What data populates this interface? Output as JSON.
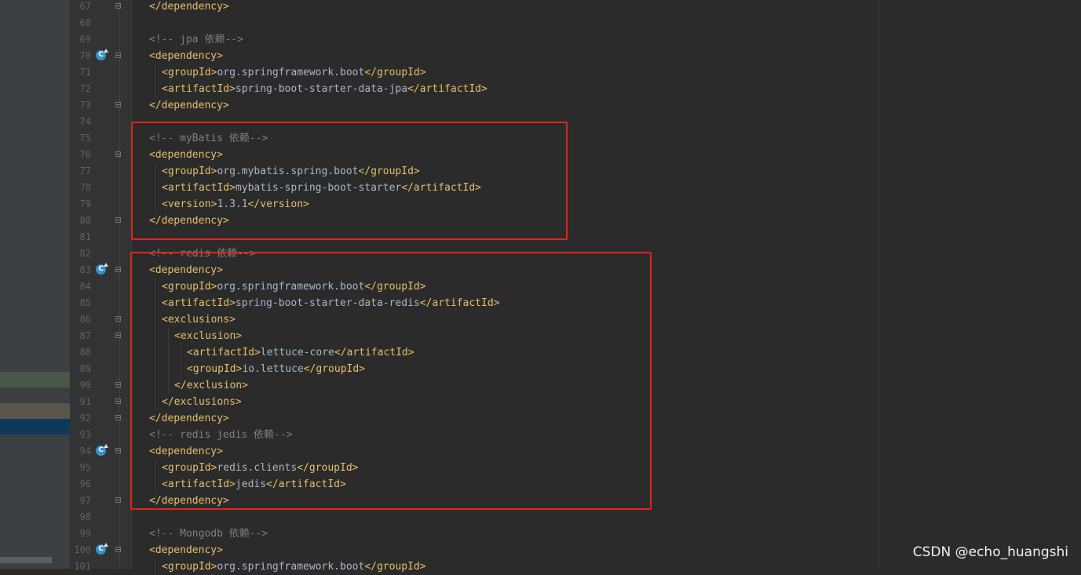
{
  "editor": {
    "lines": [
      {
        "num": "67",
        "indent": 0,
        "fold": true,
        "parts": [
          {
            "t": "tag",
            "v": "</dependency>"
          }
        ]
      },
      {
        "num": "68",
        "indent": 0,
        "parts": []
      },
      {
        "num": "69",
        "indent": 0,
        "parts": [
          {
            "t": "cmt",
            "v": "<!-- jpa 依赖-->"
          }
        ]
      },
      {
        "num": "70",
        "indent": 0,
        "badge": true,
        "fold": true,
        "parts": [
          {
            "t": "tag",
            "v": "<dependency>"
          }
        ]
      },
      {
        "num": "71",
        "indent": 1,
        "parts": [
          {
            "t": "tag",
            "v": "<groupId>"
          },
          {
            "t": "txt",
            "v": "org.springframework.boot"
          },
          {
            "t": "tag",
            "v": "</groupId>"
          }
        ]
      },
      {
        "num": "72",
        "indent": 1,
        "parts": [
          {
            "t": "tag",
            "v": "<artifactId>"
          },
          {
            "t": "txt",
            "v": "spring-boot-starter-data-jpa"
          },
          {
            "t": "tag",
            "v": "</artifactId>"
          }
        ]
      },
      {
        "num": "73",
        "indent": 0,
        "fold": true,
        "parts": [
          {
            "t": "tag",
            "v": "</dependency>"
          }
        ]
      },
      {
        "num": "74",
        "indent": 0,
        "parts": []
      },
      {
        "num": "75",
        "indent": 0,
        "parts": [
          {
            "t": "cmt",
            "v": "<!-- myBatis 依赖-->"
          }
        ]
      },
      {
        "num": "76",
        "indent": 0,
        "fold": true,
        "parts": [
          {
            "t": "tag",
            "v": "<dependency>"
          }
        ]
      },
      {
        "num": "77",
        "indent": 1,
        "parts": [
          {
            "t": "tag",
            "v": "<groupId>"
          },
          {
            "t": "txt",
            "v": "org.mybatis.spring.boot"
          },
          {
            "t": "tag",
            "v": "</groupId>"
          }
        ]
      },
      {
        "num": "78",
        "indent": 1,
        "parts": [
          {
            "t": "tag",
            "v": "<artifactId>"
          },
          {
            "t": "txt",
            "v": "mybatis-spring-boot-starter"
          },
          {
            "t": "tag",
            "v": "</artifactId>"
          }
        ]
      },
      {
        "num": "79",
        "indent": 1,
        "parts": [
          {
            "t": "tag",
            "v": "<version>"
          },
          {
            "t": "txt",
            "v": "1.3.1"
          },
          {
            "t": "tag",
            "v": "</version>"
          }
        ]
      },
      {
        "num": "80",
        "indent": 0,
        "fold": true,
        "parts": [
          {
            "t": "tag",
            "v": "</dependency>"
          }
        ]
      },
      {
        "num": "81",
        "indent": 0,
        "parts": []
      },
      {
        "num": "82",
        "indent": 0,
        "parts": [
          {
            "t": "cmt",
            "v": "<!-- redis 依赖-->"
          }
        ]
      },
      {
        "num": "83",
        "indent": 0,
        "badge": true,
        "fold": true,
        "parts": [
          {
            "t": "tag",
            "v": "<dependency>"
          }
        ]
      },
      {
        "num": "84",
        "indent": 1,
        "parts": [
          {
            "t": "tag",
            "v": "<groupId>"
          },
          {
            "t": "txt",
            "v": "org.springframework.boot"
          },
          {
            "t": "tag",
            "v": "</groupId>"
          }
        ]
      },
      {
        "num": "85",
        "indent": 1,
        "parts": [
          {
            "t": "tag",
            "v": "<artifactId>"
          },
          {
            "t": "txt",
            "v": "spring-boot-starter-data-redis"
          },
          {
            "t": "tag",
            "v": "</artifactId>"
          }
        ]
      },
      {
        "num": "86",
        "indent": 1,
        "fold": true,
        "parts": [
          {
            "t": "tag",
            "v": "<exclusions>"
          }
        ]
      },
      {
        "num": "87",
        "indent": 2,
        "fold": true,
        "parts": [
          {
            "t": "tag",
            "v": "<exclusion>"
          }
        ]
      },
      {
        "num": "88",
        "indent": 3,
        "parts": [
          {
            "t": "tag",
            "v": "<artifactId>"
          },
          {
            "t": "txt",
            "v": "lettuce-core"
          },
          {
            "t": "tag",
            "v": "</artifactId>"
          }
        ]
      },
      {
        "num": "89",
        "indent": 3,
        "parts": [
          {
            "t": "tag",
            "v": "<groupId>"
          },
          {
            "t": "txt",
            "v": "io.lettuce"
          },
          {
            "t": "tag",
            "v": "</groupId>"
          }
        ]
      },
      {
        "num": "90",
        "indent": 2,
        "fold": true,
        "parts": [
          {
            "t": "tag",
            "v": "</exclusion>"
          }
        ]
      },
      {
        "num": "91",
        "indent": 1,
        "fold": true,
        "parts": [
          {
            "t": "tag",
            "v": "</exclusions>"
          }
        ]
      },
      {
        "num": "92",
        "indent": 0,
        "fold": true,
        "parts": [
          {
            "t": "tag",
            "v": "</dependency>"
          }
        ]
      },
      {
        "num": "93",
        "indent": 0,
        "parts": [
          {
            "t": "cmt",
            "v": "<!-- redis jedis 依赖-->"
          }
        ]
      },
      {
        "num": "94",
        "indent": 0,
        "badge": true,
        "fold": true,
        "parts": [
          {
            "t": "tag",
            "v": "<dependency>"
          }
        ]
      },
      {
        "num": "95",
        "indent": 1,
        "parts": [
          {
            "t": "tag",
            "v": "<groupId>"
          },
          {
            "t": "txt",
            "v": "redis.clients"
          },
          {
            "t": "tag",
            "v": "</groupId>"
          }
        ]
      },
      {
        "num": "96",
        "indent": 1,
        "parts": [
          {
            "t": "tag",
            "v": "<artifactId>"
          },
          {
            "t": "txt",
            "v": "jedis"
          },
          {
            "t": "tag",
            "v": "</artifactId>"
          }
        ]
      },
      {
        "num": "97",
        "indent": 0,
        "fold": true,
        "parts": [
          {
            "t": "tag",
            "v": "</dependency>"
          }
        ]
      },
      {
        "num": "98",
        "indent": 0,
        "parts": []
      },
      {
        "num": "99",
        "indent": 0,
        "parts": [
          {
            "t": "cmt",
            "v": "<!-- Mongodb 依赖-->"
          }
        ]
      },
      {
        "num": "100",
        "indent": 0,
        "badge": true,
        "fold": true,
        "parts": [
          {
            "t": "tag",
            "v": "<dependency>"
          }
        ]
      },
      {
        "num": "101",
        "indent": 1,
        "parts": [
          {
            "t": "tag",
            "v": "<groupId>"
          },
          {
            "t": "txt",
            "v": "org.springframework.boot"
          },
          {
            "t": "tag",
            "v": "</groupId>"
          }
        ]
      }
    ]
  },
  "badge_glyph": "C",
  "watermark": "CSDN @echo_huangshi",
  "colors": {
    "background": "#2b2b2b",
    "gutter": "#313335",
    "tag": "#e8bf6a",
    "text": "#a9b7c6",
    "comment": "#808080",
    "line_number": "#606366",
    "highlight_box": "#e0251b"
  },
  "icons": {
    "gutter_badge": "spring-bean-icon",
    "fold_marker": "fold-icon"
  }
}
